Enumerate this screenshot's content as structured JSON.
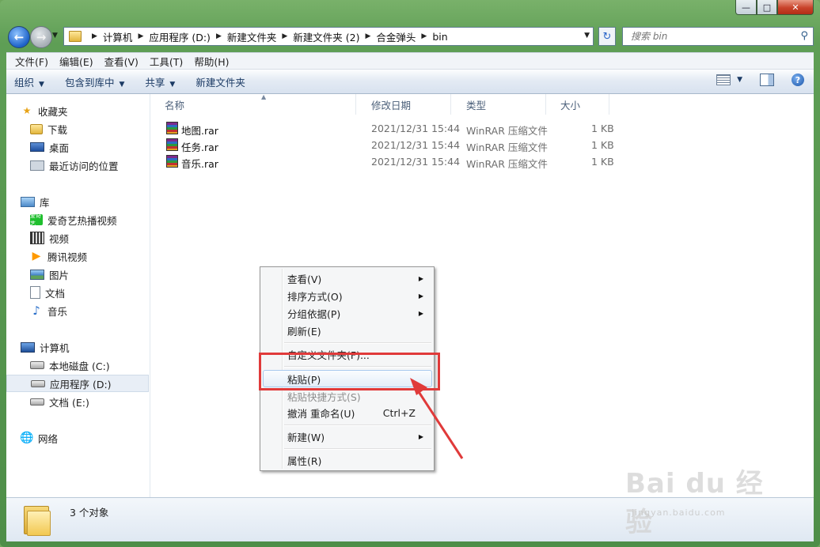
{
  "window": {
    "controls": {
      "minimize": "—",
      "maximize": "□",
      "close": "✕"
    }
  },
  "address": {
    "crumbs": [
      "计算机",
      "应用程序 (D:)",
      "新建文件夹",
      "新建文件夹 (2)",
      "合金弹头",
      "bin"
    ],
    "search_placeholder": "搜索 bin"
  },
  "menubar": [
    "文件(F)",
    "编辑(E)",
    "查看(V)",
    "工具(T)",
    "帮助(H)"
  ],
  "commands": {
    "organize": "组织",
    "include_library": "包含到库中",
    "share": "共享",
    "new_folder": "新建文件夹"
  },
  "nav": {
    "favorites": {
      "label": "收藏夹",
      "items": [
        "下载",
        "桌面",
        "最近访问的位置"
      ]
    },
    "libraries": {
      "label": "库",
      "items": [
        "爱奇艺热播视频",
        "视频",
        "腾讯视频",
        "图片",
        "文档",
        "音乐"
      ]
    },
    "computer": {
      "label": "计算机",
      "items": [
        "本地磁盘 (C:)",
        "应用程序 (D:)",
        "文档 (E:)"
      ]
    },
    "network": {
      "label": "网络"
    },
    "iqiyi_badge": "爱奇艺",
    "selected": "应用程序 (D:)"
  },
  "columns": {
    "name": "名称",
    "modified": "修改日期",
    "type": "类型",
    "size": "大小"
  },
  "files": [
    {
      "name": "地图.rar",
      "modified": "2021/12/31 15:44",
      "type": "WinRAR 压缩文件",
      "size": "1 KB"
    },
    {
      "name": "任务.rar",
      "modified": "2021/12/31 15:44",
      "type": "WinRAR 压缩文件",
      "size": "1 KB"
    },
    {
      "name": "音乐.rar",
      "modified": "2021/12/31 15:44",
      "type": "WinRAR 压缩文件",
      "size": "1 KB"
    }
  ],
  "context_menu": {
    "view": "查看(V)",
    "sort": "排序方式(O)",
    "group": "分组依据(P)",
    "refresh": "刷新(E)",
    "customize": "自定义文件夹(F)...",
    "paste": "粘贴(P)",
    "paste_shortcut": "粘贴快捷方式(S)",
    "undo_rename": "撤消 重命名(U)",
    "undo_accel": "Ctrl+Z",
    "new": "新建(W)",
    "properties": "属性(R)"
  },
  "details": {
    "count": "3 个对象"
  },
  "watermark": {
    "text": "Bai du 经验",
    "sub": "jingyan.baidu.com"
  },
  "colors": {
    "highlight_box": "#e03a3a",
    "title_green": "#5e9e55"
  }
}
